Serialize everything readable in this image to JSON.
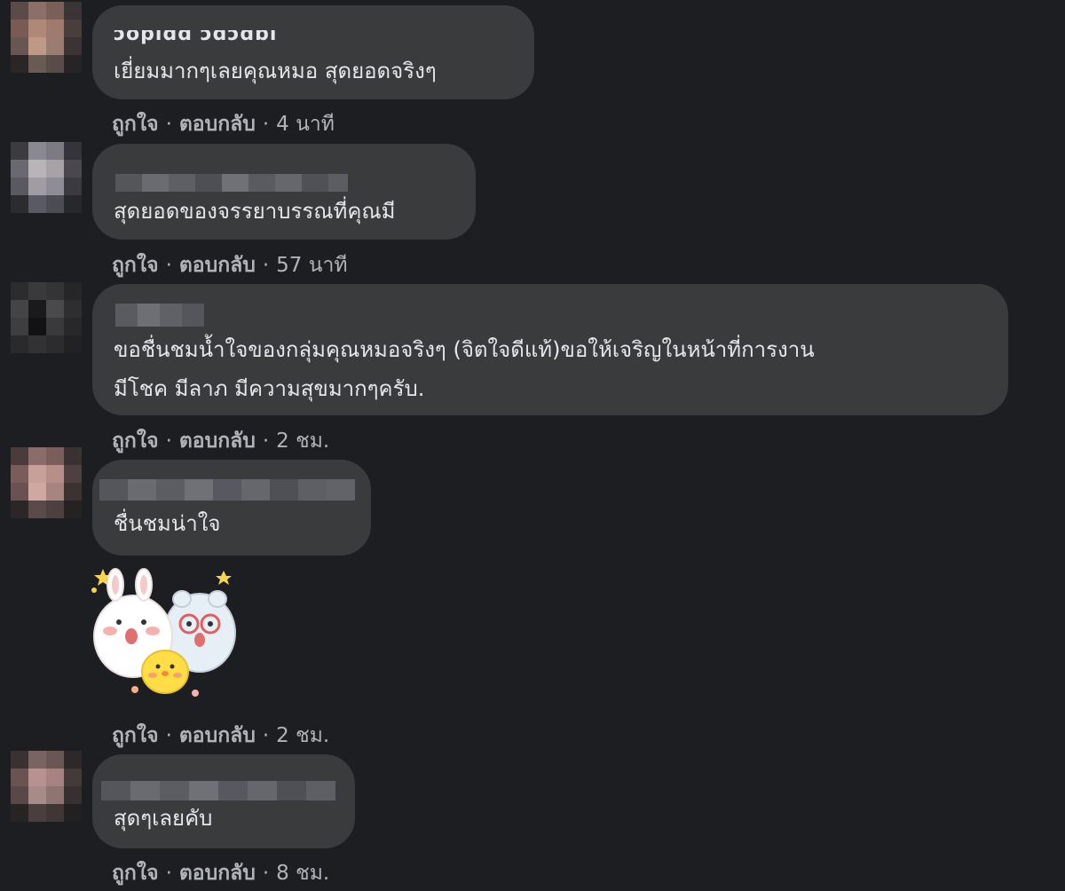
{
  "colors": {
    "background": "#1d1e21",
    "bubble": "#3a3b3c",
    "text": "#e4e6eb",
    "meta": "#b0b3b8"
  },
  "comments": [
    {
      "name_partial": "ɔopiɑɑ ɔɑɔɑɒı",
      "text": "เยี่ยมมากๆเลยคุณหมอ สุดยอดจริงๆ",
      "like": "ถูกใจ",
      "reply": "ตอบกลับ",
      "time": "4 นาที"
    },
    {
      "text": "สุดยอดของจรรยาบรรณที่คุณมี",
      "like": "ถูกใจ",
      "reply": "ตอบกลับ",
      "time": "57 นาที"
    },
    {
      "text_line1": "ขอชื่นชมน้ำใจของกลุ่มคุณหมอจริงๆ (จิตใจดีแท้)ขอให้เจริญในหน้าที่การงาน",
      "text_line2": "มีโชค มีลาภ มีความสุขมากๆครับ.",
      "like": "ถูกใจ",
      "reply": "ตอบกลับ",
      "time": "2 ชม."
    },
    {
      "text": "ชื่นชมน่าใจ",
      "sticker": "cute-animals-sticker",
      "like": "ถูกใจ",
      "reply": "ตอบกลับ",
      "time": "2 ชม."
    },
    {
      "text": "สุดๆเลยคับ",
      "like": "ถูกใจ",
      "reply": "ตอบกลับ",
      "time": "8 ชม."
    }
  ]
}
